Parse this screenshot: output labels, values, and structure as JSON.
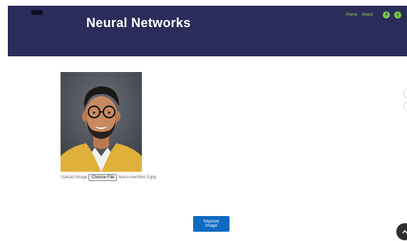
{
  "header": {
    "hero_title": "Neural Networks",
    "nav": [
      {
        "label": "Home"
      },
      {
        "label": "About"
      }
    ],
    "social": [
      {
        "icon": "facebook-icon",
        "glyph": "f"
      },
      {
        "icon": "twitter-icon",
        "glyph": "t"
      }
    ]
  },
  "upload": {
    "label": "Upload Image",
    "button_label": "Choose File",
    "file_name": "team-member-3.jpg"
  },
  "improve_button": {
    "label": "Improve Image"
  },
  "colors": {
    "header_bg": "#2b2c5a",
    "nav_text": "#8ed64a",
    "social_bg": "#7ac943",
    "primary_button": "#0e6bc2",
    "scroll_top_bg": "#2f2f2f"
  }
}
